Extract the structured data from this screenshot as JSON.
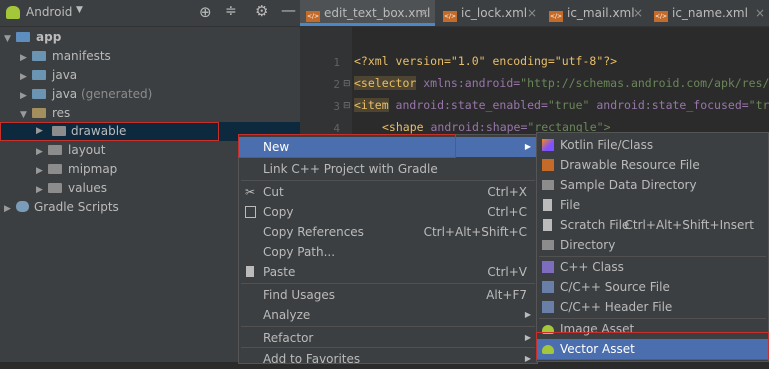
{
  "project_panel": {
    "view_selector": "Android",
    "tree": [
      {
        "label": "app",
        "bold": true
      },
      {
        "label": "manifests"
      },
      {
        "label": "java"
      },
      {
        "label": "java",
        "suffix": "(generated)"
      },
      {
        "label": "res"
      },
      {
        "label": "drawable"
      },
      {
        "label": "layout"
      },
      {
        "label": "mipmap"
      },
      {
        "label": "values"
      },
      {
        "label": "Gradle Scripts"
      }
    ]
  },
  "tabs": [
    {
      "label": "edit_text_box.xml",
      "active": true
    },
    {
      "label": "ic_lock.xml"
    },
    {
      "label": "ic_mail.xml"
    },
    {
      "label": "ic_name.xml"
    }
  ],
  "code": {
    "line_numbers": [
      "1",
      "2",
      "3",
      "4"
    ],
    "line1": "<?xml version=\"1.0\" encoding=\"utf-8\"?>",
    "line2_tag": "<selector",
    "line2_ns": " xmlns:android=",
    "line2_val": "\"http://schemas.android.com/apk/res/and",
    "line3_tag": "<item",
    "line3_attr1": " android:state_enabled=",
    "line3_val1": "\"true\"",
    "line3_attr2": " android:state_focused=",
    "line3_val2": "\"true\"",
    "line4_tag": "<shape",
    "line4_attr": " android:shape=",
    "line4_val": "\"rectangle\">"
  },
  "context_menu": [
    {
      "label": "New",
      "submenu": true
    },
    {
      "label": "Link C++ Project with Gradle"
    },
    {
      "label": "Cut",
      "shortcut": "Ctrl+X"
    },
    {
      "label": "Copy",
      "shortcut": "Ctrl+C"
    },
    {
      "label": "Copy References",
      "shortcut": "Ctrl+Alt+Shift+C"
    },
    {
      "label": "Copy Path..."
    },
    {
      "label": "Paste",
      "shortcut": "Ctrl+V"
    },
    {
      "label": "Find Usages",
      "shortcut": "Alt+F7"
    },
    {
      "label": "Analyze",
      "submenu": true
    },
    {
      "label": "Refactor",
      "submenu": true
    },
    {
      "label": "Add to Favorites",
      "submenu": true
    }
  ],
  "new_submenu": [
    {
      "label": "Kotlin File/Class",
      "icon": "kotlin-icon"
    },
    {
      "label": "Drawable Resource File",
      "icon": "xml-file-icon"
    },
    {
      "label": "Sample Data Directory",
      "icon": "folder-icon"
    },
    {
      "label": "File",
      "icon": "file-icon"
    },
    {
      "label": "Scratch File",
      "icon": "scratch-icon",
      "shortcut": "Ctrl+Alt+Shift+Insert"
    },
    {
      "label": "Directory",
      "icon": "folder-icon"
    },
    {
      "label": "C++ Class",
      "icon": "cpp-class-icon"
    },
    {
      "label": "C/C++ Source File",
      "icon": "cpp-source-icon"
    },
    {
      "label": "C/C++ Header File",
      "icon": "cpp-header-icon"
    },
    {
      "label": "Image Asset",
      "icon": "android-icon"
    },
    {
      "label": "Vector Asset",
      "icon": "android-icon"
    }
  ],
  "colors": {
    "accent": "#4b6eaf",
    "highlight_box": "#c9302c",
    "android_green": "#a4c639"
  }
}
